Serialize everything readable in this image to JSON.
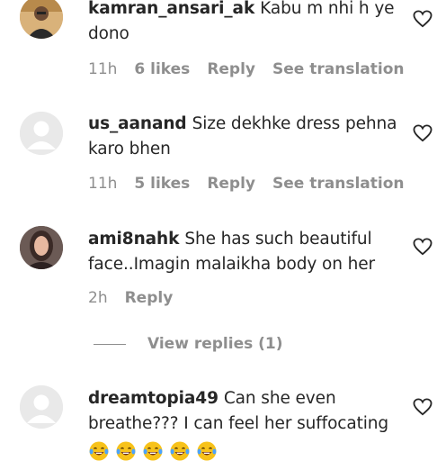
{
  "comments": [
    {
      "username": "kamran_ansari_ak",
      "text": "Kabu m nhi h ye dono",
      "time": "11h",
      "likes": "6 likes",
      "reply": "Reply",
      "translate": "See translation"
    },
    {
      "username": "us_aanand",
      "text": "Size dekhke dress pehna karo bhen",
      "time": "11h",
      "likes": "5 likes",
      "reply": "Reply",
      "translate": "See translation"
    },
    {
      "username": "ami8nahk",
      "text": "She has such beautiful face..Imagin malaikha body on her",
      "time": "2h",
      "reply": "Reply"
    },
    {
      "username": "dreamtopia49",
      "text": "Can she even breathe??? I can feel her suffocating",
      "emoji_count": 5
    }
  ],
  "view_replies": "View replies (1)",
  "colors": {
    "text": "#262626",
    "muted": "#8e8e8e",
    "emoji": "#f7c21a"
  }
}
